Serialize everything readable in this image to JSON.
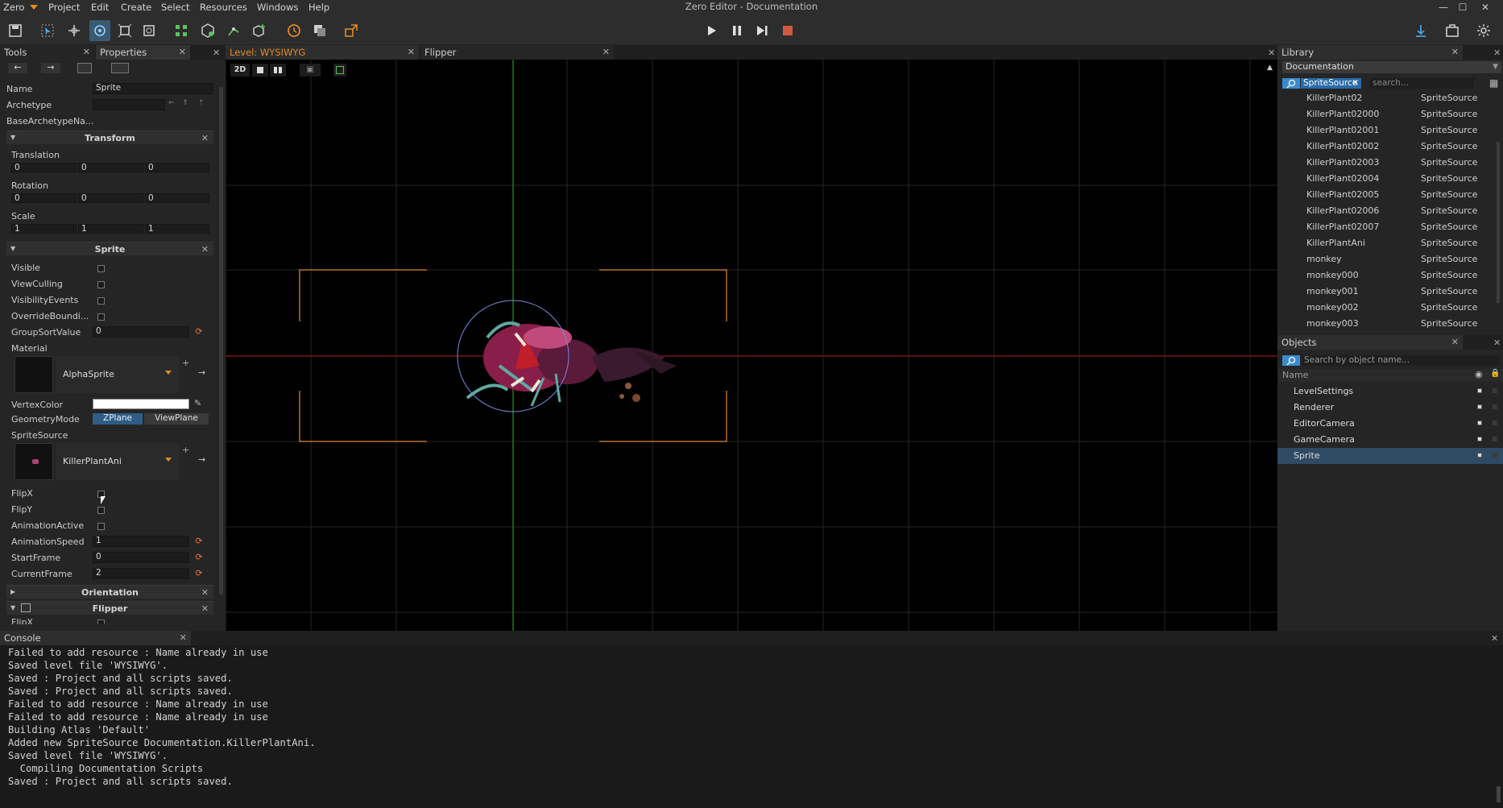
{
  "window": {
    "app_menu": "Zero",
    "title": "Zero Editor - Documentation",
    "menus": [
      "Project",
      "Edit",
      "Create",
      "Select",
      "Resources",
      "Windows",
      "Help"
    ]
  },
  "left_tabs": {
    "tools": "Tools",
    "properties": "Properties"
  },
  "properties": {
    "name_label": "Name",
    "name_value": "Sprite",
    "archetype_label": "Archetype",
    "archetype_value": "",
    "base_archetype_label": "BaseArchetypeNa...",
    "transform": {
      "title": "Transform",
      "translation_label": "Translation",
      "translation": [
        "0",
        "0",
        "0"
      ],
      "rotation_label": "Rotation",
      "rotation": [
        "0",
        "0",
        "0"
      ],
      "scale_label": "Scale",
      "scale": [
        "1",
        "1",
        "1"
      ]
    },
    "sprite": {
      "title": "Sprite",
      "visible": "Visible",
      "view_culling": "ViewCulling",
      "visibility_events": "VisibilityEvents",
      "override_bounding": "OverrideBoundi...",
      "group_sort_label": "GroupSortValue",
      "group_sort_value": "0",
      "material_label": "Material",
      "material_value": "AlphaSprite",
      "vertex_color_label": "VertexColor",
      "geometry_mode_label": "GeometryMode",
      "geometry_zplane": "ZPlane",
      "geometry_viewplane": "ViewPlane",
      "sprite_source_label": "SpriteSource",
      "sprite_source_value": "KillerPlantAni",
      "flipx": "FlipX",
      "flipy": "FlipY",
      "animation_active": "AnimationActive",
      "animation_speed_label": "AnimationSpeed",
      "animation_speed_value": "1",
      "start_frame_label": "StartFrame",
      "start_frame_value": "0",
      "current_frame_label": "CurrentFrame",
      "current_frame_value": "2"
    },
    "orientation_title": "Orientation",
    "flipper_title": "Flipper",
    "flipper_cut": "FlipX"
  },
  "viewport_tabs": {
    "level": "Level: WYSIWYG",
    "flipper": "Flipper"
  },
  "viewport_toolbar": {
    "mode_2d": "2D"
  },
  "library": {
    "tab": "Library",
    "dropdown": "Documentation",
    "filter_tag": "SpriteSource",
    "search_placeholder": "search...",
    "items": [
      {
        "name": "KillerPlant02",
        "type": "SpriteSource"
      },
      {
        "name": "KillerPlant02000",
        "type": "SpriteSource"
      },
      {
        "name": "KillerPlant02001",
        "type": "SpriteSource"
      },
      {
        "name": "KillerPlant02002",
        "type": "SpriteSource"
      },
      {
        "name": "KillerPlant02003",
        "type": "SpriteSource"
      },
      {
        "name": "KillerPlant02004",
        "type": "SpriteSource"
      },
      {
        "name": "KillerPlant02005",
        "type": "SpriteSource"
      },
      {
        "name": "KillerPlant02006",
        "type": "SpriteSource"
      },
      {
        "name": "KillerPlant02007",
        "type": "SpriteSource"
      },
      {
        "name": "KillerPlantAni",
        "type": "SpriteSource"
      },
      {
        "name": "monkey",
        "type": "SpriteSource"
      },
      {
        "name": "monkey000",
        "type": "SpriteSource"
      },
      {
        "name": "monkey001",
        "type": "SpriteSource"
      },
      {
        "name": "monkey002",
        "type": "SpriteSource"
      },
      {
        "name": "monkey003",
        "type": "SpriteSource"
      }
    ]
  },
  "objects": {
    "tab": "Objects",
    "search_placeholder": "Search by object name...",
    "column_name": "Name",
    "items": [
      "LevelSettings",
      "Renderer",
      "EditorCamera",
      "GameCamera",
      "Sprite"
    ],
    "selected": "Sprite"
  },
  "console": {
    "tab": "Console",
    "lines": [
      "Failed to add resource : Name already in use",
      "Saved level file 'WYSIWYG'.",
      "Saved : Project and all scripts saved.",
      "Saved : Project and all scripts saved.",
      "Failed to add resource : Name already in use",
      "Failed to add resource : Name already in use",
      "Building Atlas 'Default'",
      "Added new SpriteSource Documentation.KillerPlantAni.",
      "Saved level file 'WYSIWYG'.",
      "  Compiling Documentation Scripts",
      "Saved : Project and all scripts saved."
    ]
  },
  "colors": {
    "accent": "#3a5a72",
    "selection": "#2f4a63",
    "orange": "#e08a2a",
    "axis_x": "#8a1a1a",
    "axis_y": "#1a8a1a"
  }
}
